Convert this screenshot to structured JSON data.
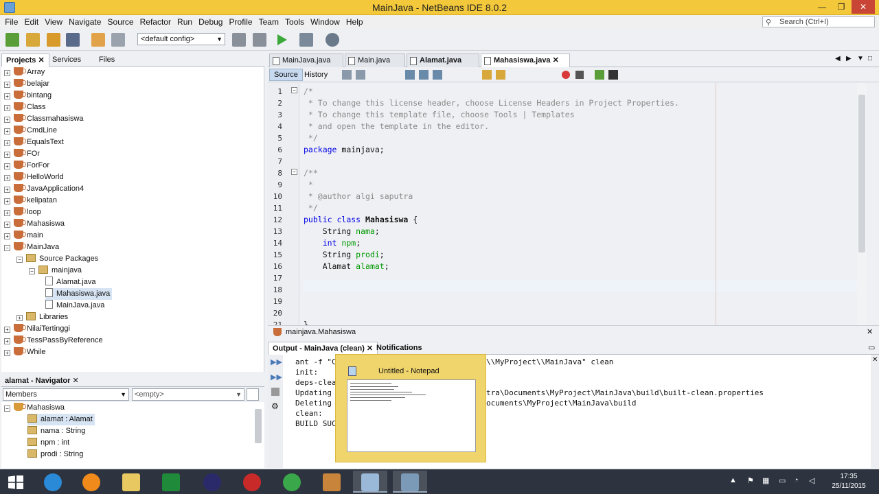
{
  "window": {
    "title": "MainJava - NetBeans IDE 8.0.2",
    "min": "—",
    "max": "❐",
    "close": "✕"
  },
  "menu": [
    "File",
    "Edit",
    "View",
    "Navigate",
    "Source",
    "Refactor",
    "Run",
    "Debug",
    "Profile",
    "Team",
    "Tools",
    "Window",
    "Help"
  ],
  "search": {
    "placeholder": "Search (Ctrl+I)"
  },
  "toolbar": {
    "config": "<default config>"
  },
  "project_tabs": [
    "Projects",
    "Services",
    "Files"
  ],
  "projects": [
    "Array",
    "belajar",
    "bintang",
    "Class",
    "Classmahasiswa",
    "CmdLine",
    "EqualsText",
    "FOr",
    "ForFor",
    "HelloWorld",
    "JavaApplication4",
    "kelipatan",
    "loop",
    "Mahasiswa",
    "main",
    "MainJava"
  ],
  "mainjava_children": {
    "source_packages": "Source Packages",
    "package": "mainjava",
    "files": [
      "Alamat.java",
      "Mahasiswa.java",
      "MainJava.java"
    ],
    "libraries": "Libraries"
  },
  "projects_after": [
    "NilaiTertinggi",
    "TessPassByReference",
    "While"
  ],
  "navigator": {
    "title": "alamat - Navigator",
    "members": "Members",
    "empty": "<empty>",
    "root": "Mahasiswa",
    "items": [
      "alamat : Alamat",
      "nama : String",
      "npm : int",
      "prodi : String"
    ]
  },
  "editor_tabs": [
    "MainJava.java",
    "Main.java",
    "Alamat.java",
    "Mahasiswa.java"
  ],
  "editor_toolbar": {
    "source": "Source",
    "history": "History"
  },
  "code": [
    "/*",
    " * To change this license header, choose License Headers in Project Properties.",
    " * To change this template file, choose Tools | Templates",
    " * and open the template in the editor.",
    " */",
    "package mainjava;",
    "",
    "/**",
    " *",
    " * @author algi saputra",
    " */",
    "public class Mahasiswa {",
    "    String nama;",
    "    int npm;",
    "    String prodi;",
    "    Alamat alamat;",
    "",
    "",
    "",
    "",
    "}"
  ],
  "line_numbers": [
    "1",
    "2",
    "3",
    "4",
    "5",
    "6",
    "7",
    "8",
    "9",
    "10",
    "11",
    "12",
    "13",
    "14",
    "15",
    "16",
    "17",
    "18",
    "19",
    "20",
    "21"
  ],
  "breadcrumb": "mainjava.Mahasiswa",
  "output_tabs": [
    "Output - MainJava (clean)",
    "Notifications"
  ],
  "output_lines": [
    "ant -f \"C",
    "init:",
    "deps-clea",
    "Updating",
    "Deleting",
    "clean:",
    "BUILD SUC"
  ],
  "output_lines_right": [
    "\\\\MyProject\\\\MainJava\" clean",
    "",
    "",
    "tra\\Documents\\MyProject\\MainJava\\build\\built-clean.properties",
    "ocuments\\MyProject\\MainJava\\build",
    "",
    ""
  ],
  "notepad_preview": {
    "title": "Untitled - Notepad"
  },
  "clock": {
    "time": "17:35",
    "date": "25/11/2015"
  },
  "colors": {
    "titlebar": "#f3c83a",
    "taskbar": "#2d3440",
    "keyword": "#0000e6",
    "comment": "#8a8a8a",
    "field": "#009900"
  }
}
